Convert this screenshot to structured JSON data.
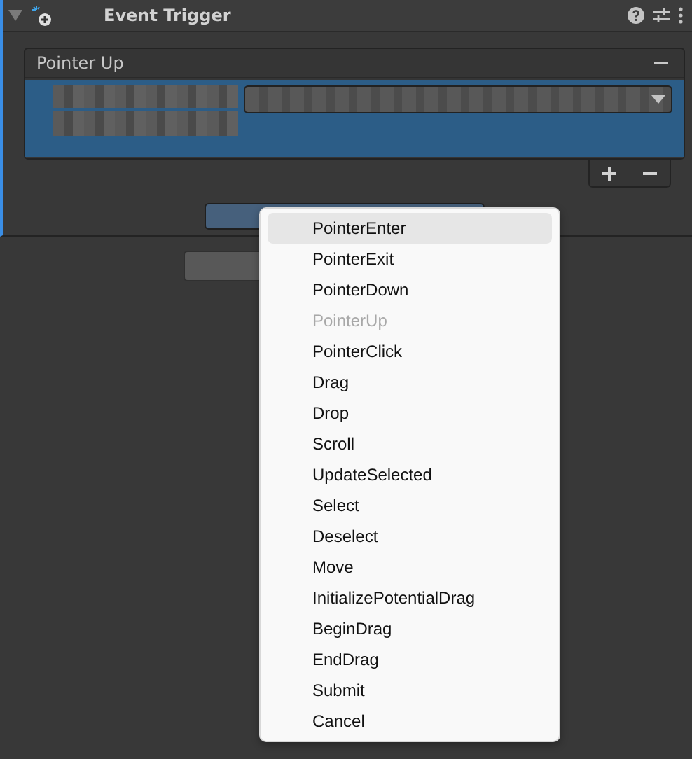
{
  "component": {
    "title": "Event Trigger",
    "expanded": true
  },
  "entries": [
    {
      "label": "Pointer Up",
      "selected": true
    }
  ],
  "menu": {
    "items": [
      {
        "label": "PointerEnter",
        "highlighted": true,
        "disabled": false
      },
      {
        "label": "PointerExit",
        "highlighted": false,
        "disabled": false
      },
      {
        "label": "PointerDown",
        "highlighted": false,
        "disabled": false
      },
      {
        "label": "PointerUp",
        "highlighted": false,
        "disabled": true
      },
      {
        "label": "PointerClick",
        "highlighted": false,
        "disabled": false
      },
      {
        "label": "Drag",
        "highlighted": false,
        "disabled": false
      },
      {
        "label": "Drop",
        "highlighted": false,
        "disabled": false
      },
      {
        "label": "Scroll",
        "highlighted": false,
        "disabled": false
      },
      {
        "label": "UpdateSelected",
        "highlighted": false,
        "disabled": false
      },
      {
        "label": "Select",
        "highlighted": false,
        "disabled": false
      },
      {
        "label": "Deselect",
        "highlighted": false,
        "disabled": false
      },
      {
        "label": "Move",
        "highlighted": false,
        "disabled": false
      },
      {
        "label": "InitializePotentialDrag",
        "highlighted": false,
        "disabled": false
      },
      {
        "label": "BeginDrag",
        "highlighted": false,
        "disabled": false
      },
      {
        "label": "EndDrag",
        "highlighted": false,
        "disabled": false
      },
      {
        "label": "Submit",
        "highlighted": false,
        "disabled": false
      },
      {
        "label": "Cancel",
        "highlighted": false,
        "disabled": false
      }
    ]
  }
}
